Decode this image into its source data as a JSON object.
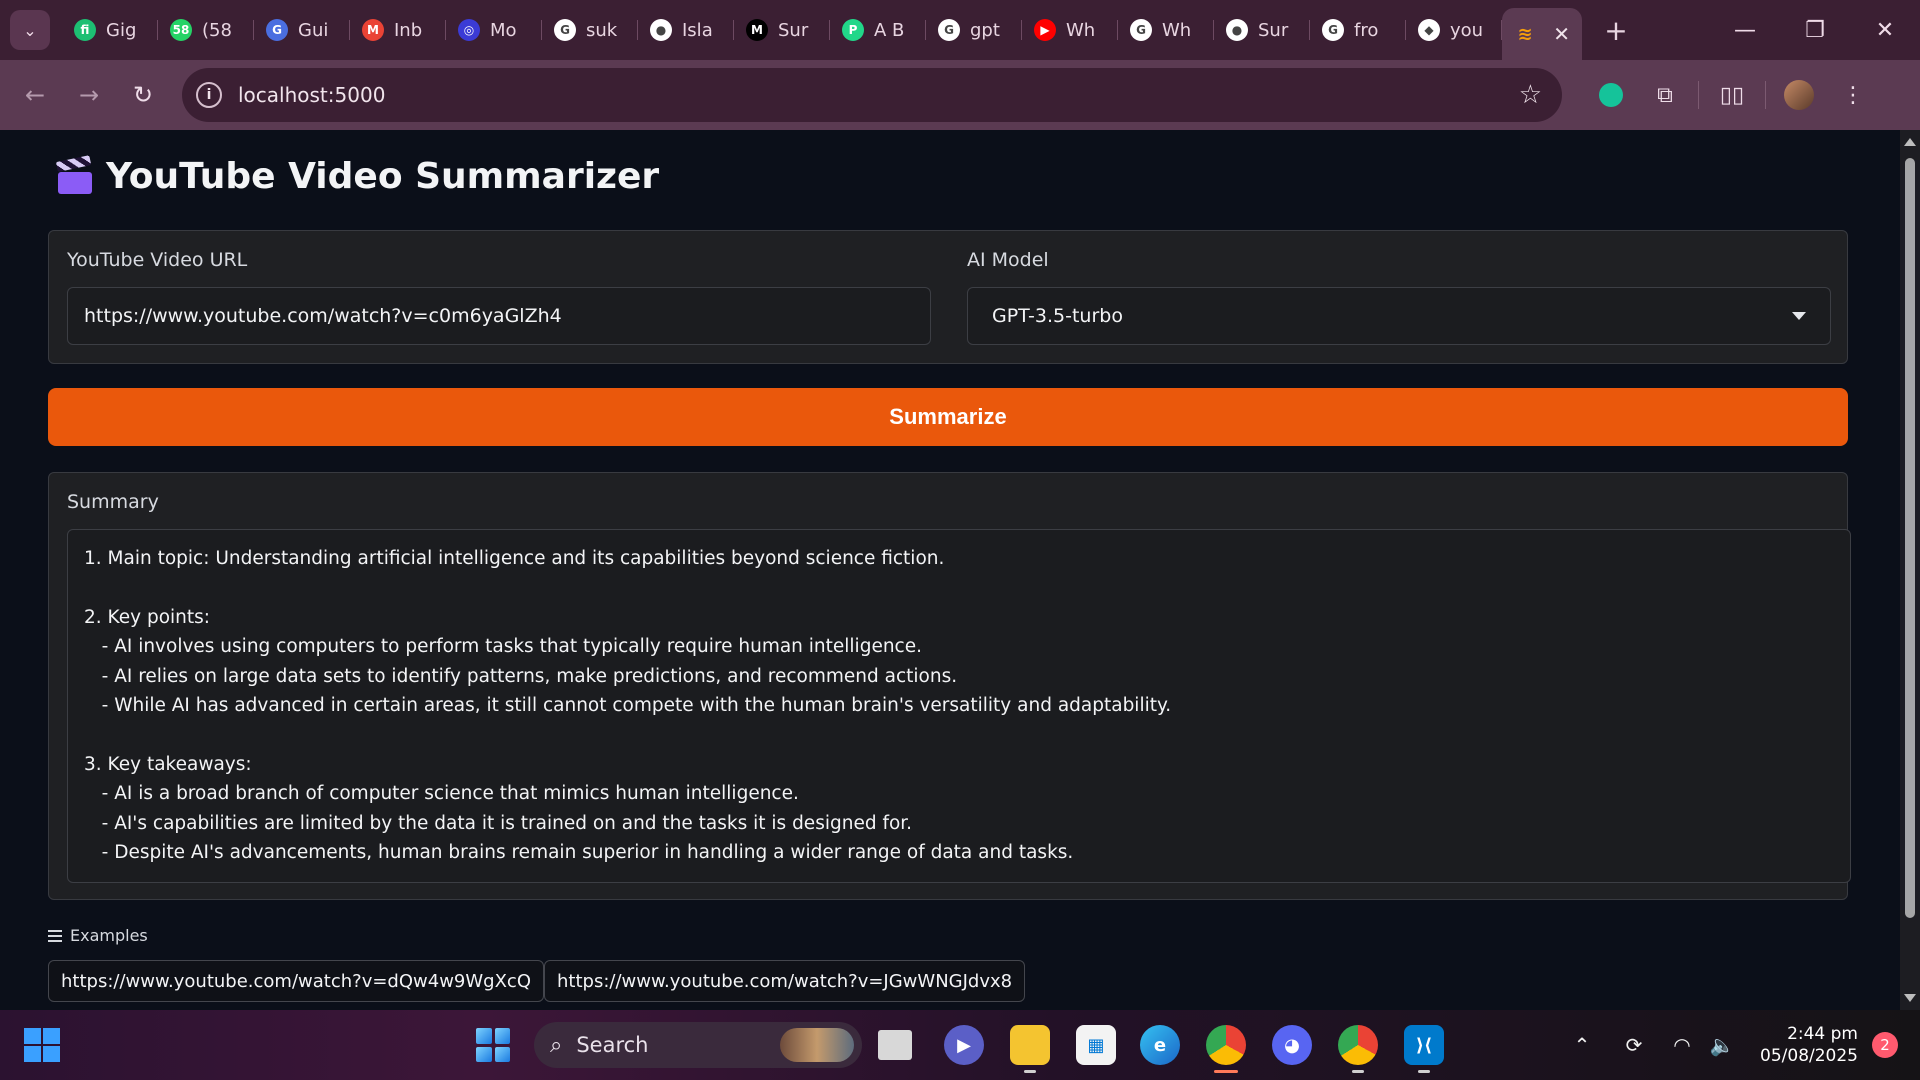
{
  "browser": {
    "tabs": [
      {
        "label": "Gig",
        "icon": "fiverr-icon",
        "color": "#1dbf73",
        "glyph": "fi"
      },
      {
        "label": "(58",
        "icon": "whatsapp-icon",
        "color": "#25d366",
        "glyph": "58"
      },
      {
        "label": "Gui",
        "icon": "grammarly-icon",
        "color": "#4a6ee0",
        "glyph": "G"
      },
      {
        "label": "Inb",
        "icon": "gmail-icon",
        "color": "#ea4335",
        "glyph": "M"
      },
      {
        "label": "Mo",
        "icon": "openai-icon",
        "color": "#3b3bd6",
        "glyph": "◎"
      },
      {
        "label": "suk",
        "icon": "google-icon",
        "color": "#ffffff",
        "glyph": "G"
      },
      {
        "label": "Isla",
        "icon": "github-icon",
        "color": "#ffffff",
        "glyph": "●"
      },
      {
        "label": "Sur",
        "icon": "medium-icon",
        "color": "#000000",
        "glyph": "M"
      },
      {
        "label": "A B",
        "icon": "pycharm-icon",
        "color": "#21d789",
        "glyph": "P"
      },
      {
        "label": "gpt",
        "icon": "google-icon",
        "color": "#ffffff",
        "glyph": "G"
      },
      {
        "label": "Wh",
        "icon": "youtube-icon",
        "color": "#ff0000",
        "glyph": "▶"
      },
      {
        "label": "Wh",
        "icon": "google-icon",
        "color": "#ffffff",
        "glyph": "G"
      },
      {
        "label": "Sur",
        "icon": "github-icon",
        "color": "#ffffff",
        "glyph": "●"
      },
      {
        "label": "fro",
        "icon": "google-icon",
        "color": "#ffffff",
        "glyph": "G"
      },
      {
        "label": "you",
        "icon": "cube-icon",
        "color": "#ffffff",
        "glyph": "◆"
      }
    ],
    "url": "localhost:5000"
  },
  "app": {
    "title": "YouTube Video Summarizer",
    "url_label": "YouTube Video URL",
    "url_value": "https://www.youtube.com/watch?v=c0m6yaGlZh4",
    "model_label": "AI Model",
    "model_value": "GPT-3.5-turbo",
    "button_label": "Summarize",
    "summary_label": "Summary",
    "summary_text": "1. Main topic: Understanding artificial intelligence and its capabilities beyond science fiction.\n\n2. Key points:\n   - AI involves using computers to perform tasks that typically require human intelligence.\n   - AI relies on large data sets to identify patterns, make predictions, and recommend actions.\n   - While AI has advanced in certain areas, it still cannot compete with the human brain's versatility and adaptability.\n\n3. Key takeaways:\n   - AI is a broad branch of computer science that mimics human intelligence.\n   - AI's capabilities are limited by the data it is trained on and the tasks it is designed for.\n   - Despite AI's advancements, human brains remain superior in handling a wider range of data and tasks.",
    "examples_label": "Examples",
    "examples": [
      "https://www.youtube.com/watch?v=dQw4w9WgXcQ",
      "https://www.youtube.com/watch?v=JGwWNGJdvx8"
    ]
  },
  "taskbar": {
    "search_label": "Search",
    "time": "2:44 pm",
    "date": "05/08/2025",
    "notifications": "2"
  },
  "colors": {
    "accent": "#ea580c",
    "page_bg": "#0b0f19",
    "panel_bg": "#1f2023"
  }
}
